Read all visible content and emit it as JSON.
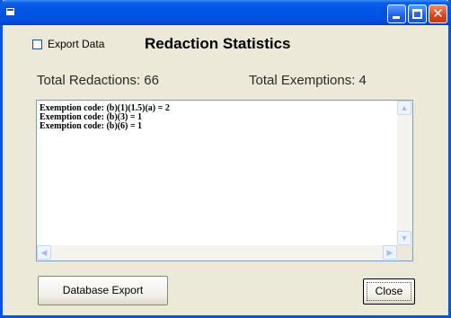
{
  "window": {
    "app_icon": "window-app-icon",
    "controls": {
      "minimize_icon": "minimize-icon",
      "maximize_icon": "maximize-icon",
      "close_symbol": "✕"
    }
  },
  "export_data": {
    "label": "Export Data",
    "checked": false
  },
  "title": "Redaction Statistics",
  "stats": {
    "total_redactions": "Total Redactions: 66",
    "total_exemptions": "Total Exemptions: 4"
  },
  "exemption_lines": [
    "Exemption code: (b)(1)(1.5)(a) = 2",
    "Exemption code: (b)(3) = 1",
    "Exemption code: (b)(6) = 1"
  ],
  "scrollbar_arrows": {
    "up": "▲",
    "down": "▼",
    "left": "◀",
    "right": "▶"
  },
  "buttons": {
    "database_export": "Database Export",
    "close": "Close"
  },
  "colors": {
    "titlebar": "#0054e3",
    "window_face": "#ece9d8",
    "close_control": "#d9451d"
  }
}
